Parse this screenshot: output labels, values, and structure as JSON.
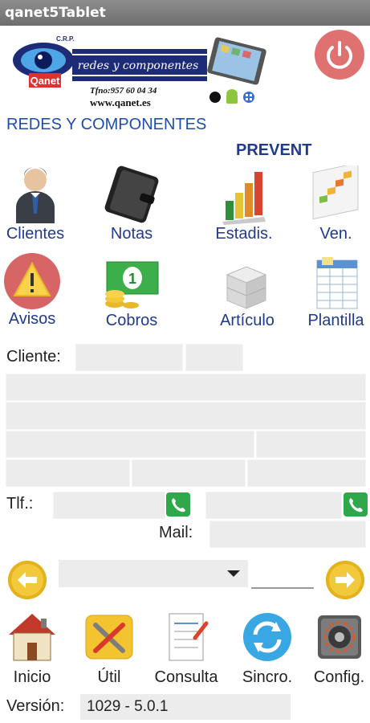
{
  "app": {
    "title": "qanet5Tablet"
  },
  "header": {
    "logo": {
      "brand": "Qanet",
      "crp": "C.R.P.",
      "slogan": "redes y componentes",
      "phone": "Tfno:957 60 04 34",
      "web": "www.qanet.es"
    },
    "company": "REDES Y COMPONENTES",
    "mode": "PREVENT"
  },
  "menu": {
    "row1": [
      {
        "label": "Clientes",
        "icon": "user-icon"
      },
      {
        "label": "Notas",
        "icon": "notebook-icon"
      },
      {
        "label": "Estadis.",
        "icon": "bar-chart-icon"
      },
      {
        "label": "Ven.",
        "icon": "sales-chart-icon"
      }
    ],
    "row2": [
      {
        "label": "Avisos",
        "icon": "warning-icon"
      },
      {
        "label": "Cobros",
        "icon": "money-icon"
      },
      {
        "label": "Artículo",
        "icon": "boxes-icon"
      },
      {
        "label": "Plantilla",
        "icon": "spreadsheet-icon"
      }
    ]
  },
  "form": {
    "cliente_label": "Cliente:",
    "tlf_label": "Tlf.:",
    "mail_label": "Mail:"
  },
  "bottom_nav": [
    {
      "label": "Inicio",
      "icon": "home-icon"
    },
    {
      "label": "Útil",
      "icon": "tools-icon"
    },
    {
      "label": "Consulta",
      "icon": "consult-icon"
    },
    {
      "label": "Sincro.",
      "icon": "sync-icon"
    },
    {
      "label": "Config.",
      "icon": "config-icon"
    }
  ],
  "footer": {
    "version_label": "Versión:",
    "version_value": "1029 - 5.0.1"
  },
  "colors": {
    "primary_text": "#1f3a8f",
    "power": "#e07171",
    "phone_green": "#2ea84a",
    "nav_yellow": "#f1c93a"
  }
}
